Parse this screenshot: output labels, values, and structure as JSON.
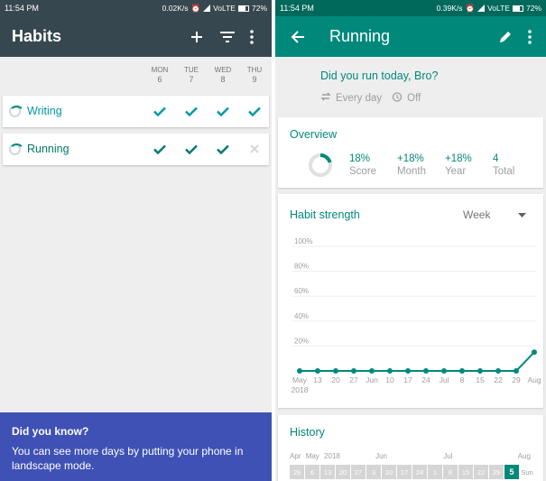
{
  "status_left": {
    "time": "11:54 PM",
    "speed": "0.02K/s",
    "network": "VoLTE",
    "battery": "72%"
  },
  "status_right": {
    "time": "11:54 PM",
    "speed": "0.39K/s",
    "network": "VoLTE",
    "battery": "72%"
  },
  "habits_screen": {
    "title": "Habits",
    "days": [
      {
        "name": "MON",
        "num": "6"
      },
      {
        "name": "TUE",
        "num": "7"
      },
      {
        "name": "WED",
        "num": "8"
      },
      {
        "name": "THU",
        "num": "9"
      }
    ],
    "habits": [
      {
        "name": "Writing",
        "checks": [
          "done",
          "done",
          "done",
          "done"
        ]
      },
      {
        "name": "Running",
        "checks": [
          "done",
          "done",
          "done",
          "missed"
        ]
      }
    ],
    "tip": {
      "title": "Did you know?",
      "text": "You can see more days by putting your phone in landscape mode."
    }
  },
  "running_screen": {
    "title": "Running",
    "question": "Did you run today, Bro?",
    "frequency": "Every day",
    "reminder": "Off",
    "overview": {
      "title": "Overview",
      "stats": [
        {
          "value": "18%",
          "label": "Score"
        },
        {
          "value": "+18%",
          "label": "Month"
        },
        {
          "value": "+18%",
          "label": "Year"
        },
        {
          "value": "4",
          "label": "Total"
        }
      ]
    },
    "strength": {
      "title": "Habit strength",
      "period": "Week"
    },
    "history": {
      "title": "History",
      "month_labels": [
        "Apr",
        "May",
        "2018",
        "Jun",
        "Jul",
        "Aug"
      ],
      "cells": [
        "29",
        "6",
        "13",
        "20",
        "27",
        "3",
        "10",
        "17",
        "24",
        "1",
        "8",
        "15",
        "22",
        "29",
        "5"
      ],
      "weekday": "Sun"
    }
  },
  "chart_data": {
    "type": "line",
    "y_ticks": [
      "100%",
      "80%",
      "60%",
      "40%",
      "20%"
    ],
    "x_labels": [
      "May",
      "13",
      "20",
      "27",
      "Jun",
      "10",
      "17",
      "24",
      "Jul",
      "8",
      "15",
      "22",
      "29",
      "Aug"
    ],
    "x_sub_label": "2018",
    "values": [
      0,
      0,
      0,
      0,
      0,
      0,
      0,
      0,
      0,
      0,
      0,
      0,
      0,
      0.15
    ],
    "ylim": [
      0,
      1
    ],
    "accent": "#00897b"
  }
}
